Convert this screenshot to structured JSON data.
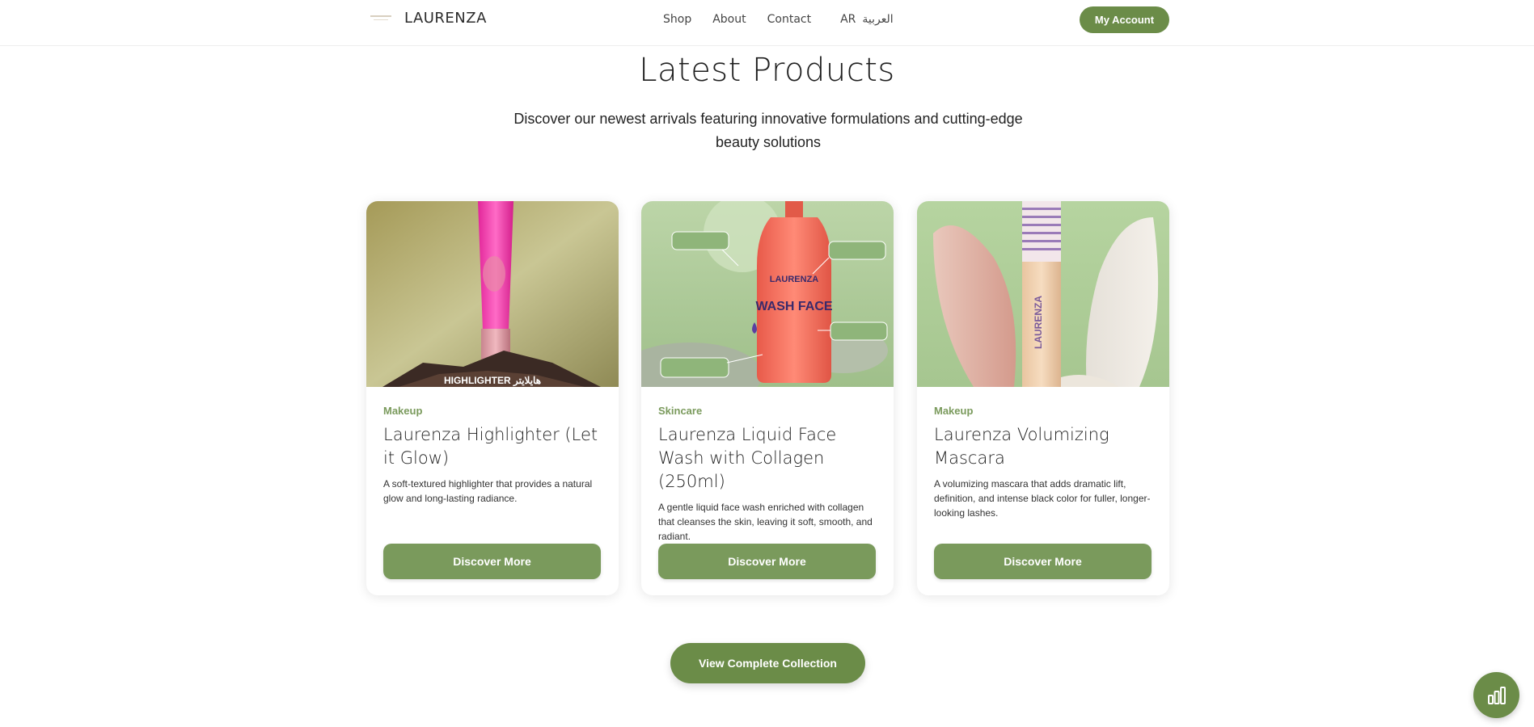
{
  "header": {
    "brand": "LAURENZA",
    "nav": [
      {
        "label": "Shop"
      },
      {
        "label": "About"
      },
      {
        "label": "Contact"
      }
    ],
    "lang_code": "AR",
    "lang_native": "العربية",
    "account_label": "My Account"
  },
  "section": {
    "title": "Latest Products",
    "subtitle": "Discover our newest arrivals featuring innovative formulations and cutting-edge beauty solutions"
  },
  "products": [
    {
      "category": "Makeup",
      "title": "Laurenza Highlighter (Let it Glow)",
      "description": "A soft-textured highlighter that provides a natural glow and long-lasting radiance.",
      "button": "Discover More",
      "image_caption": "HIGHLIGHTER هايلايتر"
    },
    {
      "category": "Skincare",
      "title": "Laurenza Liquid Face Wash with Collagen (250ml)",
      "description": "A gentle liquid face wash enriched with collagen that cleanses the skin, leaving it soft, smooth, and radiant.",
      "button": "Discover More",
      "image_label_brand": "LAURENZA",
      "image_label_product": "WASH FACE"
    },
    {
      "category": "Makeup",
      "title": "Laurenza Volumizing Mascara",
      "description": "A volumizing mascara that adds dramatic lift, definition, and intense black color for fuller, longer-looking lashes.",
      "button": "Discover More",
      "image_label_brand": "LAURENZA"
    }
  ],
  "cta": {
    "view_collection": "View Complete Collection"
  },
  "colors": {
    "accent": "#6b8c48",
    "button": "#7a9a5c",
    "category": "#7a9a5c"
  },
  "icons": {
    "fab": "bar-chart-icon"
  }
}
